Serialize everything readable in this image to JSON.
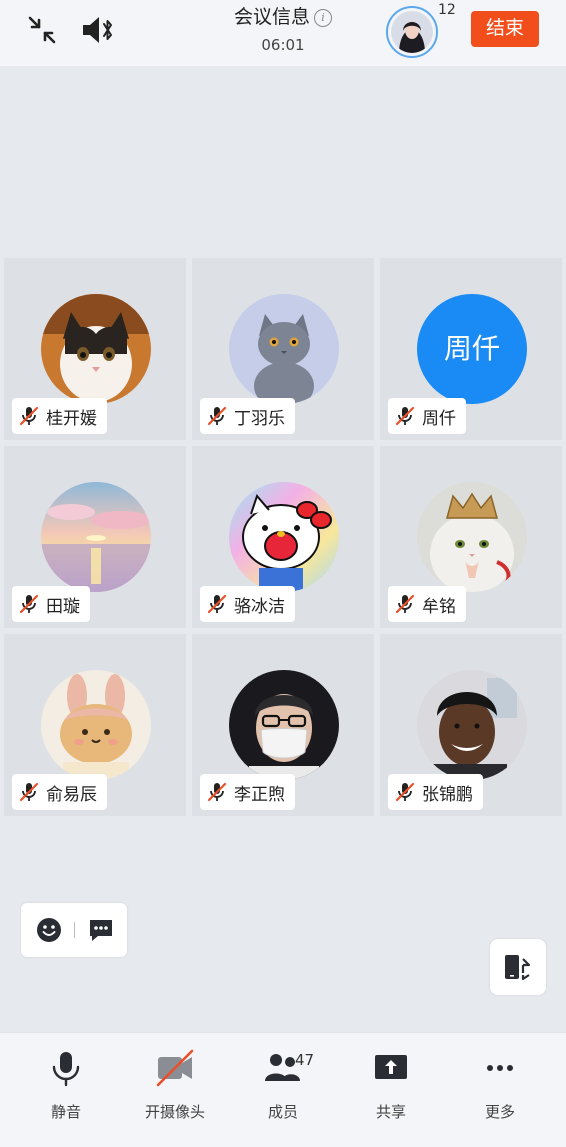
{
  "header": {
    "title": "会议信息",
    "timer": "06:01",
    "participant_count": "12",
    "end_button": "结束"
  },
  "participants": [
    {
      "name": "桂开媛",
      "avatar": "cat-photo-avatar",
      "muted": true
    },
    {
      "name": "丁羽乐",
      "avatar": "gray-kitten-avatar",
      "muted": true
    },
    {
      "name": "周仟",
      "avatar_text": "周仟",
      "avatar_color": "#1a8af5",
      "muted": true
    },
    {
      "name": "田璇",
      "avatar": "sunset-clouds-avatar",
      "muted": true
    },
    {
      "name": "骆冰洁",
      "avatar": "hello-kitty-avatar",
      "muted": true
    },
    {
      "name": "牟铭",
      "avatar": "crowned-cat-avatar",
      "muted": true
    },
    {
      "name": "俞易辰",
      "avatar": "bunny-plush-avatar",
      "muted": true
    },
    {
      "name": "李正煦",
      "avatar": "masked-man-avatar",
      "muted": true
    },
    {
      "name": "张锦鹏",
      "avatar": "smiling-man-avatar",
      "muted": true
    }
  ],
  "toolbar": {
    "mute_label": "静音",
    "camera_label": "开摄像头",
    "members_label": "成员",
    "members_count": "47",
    "share_label": "共享",
    "more_label": "更多"
  },
  "colors": {
    "end_button": "#f14e1c",
    "text_avatar": "#1a8af5",
    "muted_mic": "#e8502a"
  }
}
